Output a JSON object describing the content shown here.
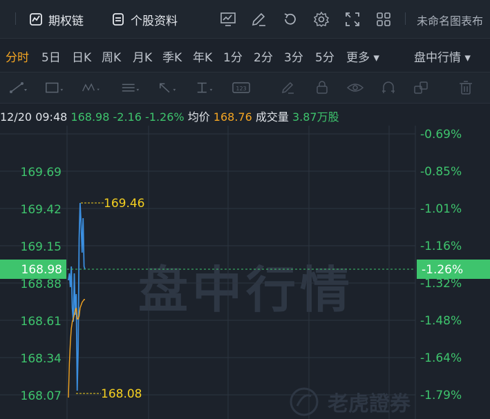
{
  "topbar": {
    "options_label": "期权链",
    "stock_info_label": "个股资料",
    "chart_title": "未命名图表布"
  },
  "periods": {
    "items": [
      "分时",
      "5日",
      "日K",
      "周K",
      "月K",
      "季K",
      "年K",
      "1分",
      "2分",
      "3分",
      "5分",
      "更多 ▾"
    ],
    "active": "分时",
    "intraday_dropdown": "盘中行情 ▾"
  },
  "info": {
    "datetime": "12/20 09:48",
    "price": "168.98",
    "change": "-2.16",
    "change_pct": "-1.26%",
    "avg_label": "均价",
    "avg_value": "168.76",
    "volume_label": "成交量",
    "volume_value": "3.87万股"
  },
  "colors": {
    "up_green": "#3ec46d",
    "avg_orange": "#f5a623",
    "price_line": "#3b8fe0",
    "current_badge": "#3ec46d"
  },
  "watermark": {
    "text": "盘中行情",
    "brand": "老虎證券"
  },
  "chart_data": {
    "type": "line",
    "title": "",
    "left_ticks": [
      "169.69",
      "169.42",
      "169.15",
      "168.88",
      "168.61",
      "168.34",
      "168.07"
    ],
    "right_ticks": [
      "-0.69%",
      "-0.85%",
      "-1.01%",
      "-1.16%",
      "-1.32%",
      "-1.48%",
      "-1.64%",
      "-1.79%"
    ],
    "current_price_label": "168.98",
    "current_pct_label": "-1.26%",
    "high_label": "169.46",
    "low_label": "168.08",
    "ylim": [
      168.07,
      169.96
    ],
    "price_series": [
      168.9,
      168.95,
      168.85,
      169.0,
      168.7,
      168.6,
      168.95,
      168.65,
      168.8,
      168.1,
      168.4,
      169.2,
      169.46,
      169.3,
      169.1,
      169.35,
      169.0,
      168.98
    ],
    "avg_series": [
      168.05,
      168.3,
      168.45,
      168.55,
      168.6,
      168.62,
      168.65,
      168.68,
      168.7,
      168.62,
      168.62,
      168.64,
      168.7,
      168.72,
      168.74,
      168.75,
      168.76,
      168.76
    ]
  }
}
